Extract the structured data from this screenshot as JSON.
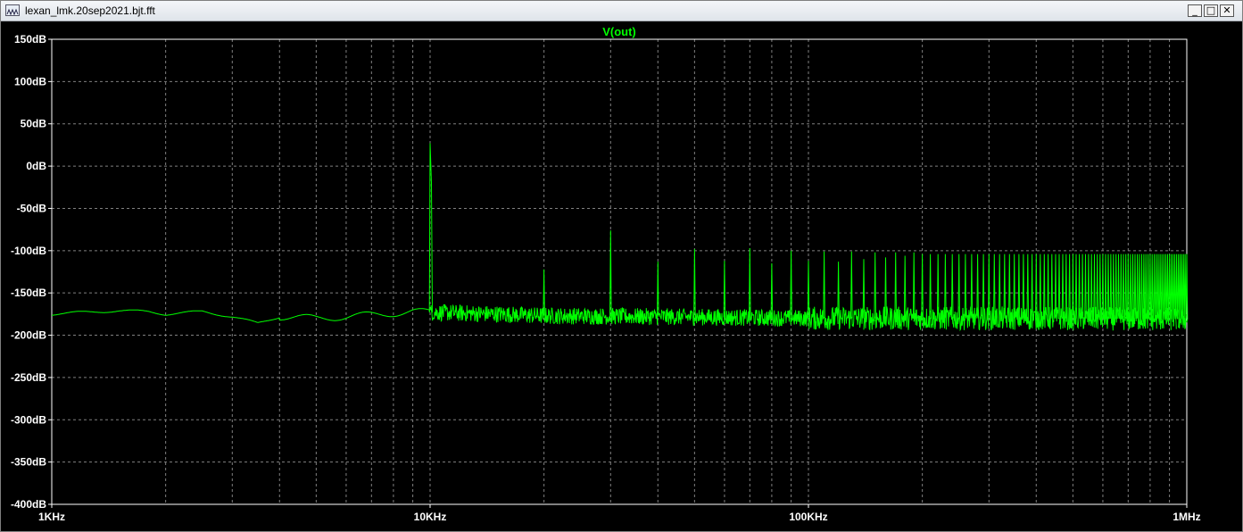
{
  "window": {
    "title": "lexan_lmk.20sep2021.bjt.fft",
    "icon": "waveform-viewer-icon",
    "buttons": {
      "minimize": "_",
      "maximize": "□",
      "close": "✕"
    }
  },
  "colors": {
    "background": "#000000",
    "grid": "#808080",
    "axis_text": "#ffffff",
    "trace": "#00ff00"
  },
  "chart_data": {
    "type": "line",
    "title": "V(out)",
    "x_scale": "log",
    "xlim": [
      1000,
      1000000
    ],
    "ylim": [
      -400,
      150
    ],
    "x_ticks": [
      {
        "value": 1000,
        "label": "1KHz"
      },
      {
        "value": 10000,
        "label": "10KHz"
      },
      {
        "value": 100000,
        "label": "100KHz"
      },
      {
        "value": 1000000,
        "label": "1MHz"
      }
    ],
    "y_ticks": [
      {
        "value": 150,
        "label": "150dB"
      },
      {
        "value": 100,
        "label": "100dB"
      },
      {
        "value": 50,
        "label": "50dB"
      },
      {
        "value": 0,
        "label": "0dB"
      },
      {
        "value": -50,
        "label": "-50dB"
      },
      {
        "value": -100,
        "label": "-100dB"
      },
      {
        "value": -150,
        "label": "-150dB"
      },
      {
        "value": -200,
        "label": "-200dB"
      },
      {
        "value": -250,
        "label": "-250dB"
      },
      {
        "value": -300,
        "label": "-300dB"
      },
      {
        "value": -350,
        "label": "-350dB"
      },
      {
        "value": -400,
        "label": "-400dB"
      }
    ],
    "grid": true,
    "series": [
      {
        "name": "V(out)",
        "color": "#00ff00",
        "noise_floor_points": [
          [
            1000,
            -175
          ],
          [
            1200,
            -173
          ],
          [
            1500,
            -171
          ],
          [
            1800,
            -172
          ],
          [
            2000,
            -175
          ],
          [
            2500,
            -172
          ],
          [
            3000,
            -178
          ],
          [
            3500,
            -186
          ],
          [
            4000,
            -178
          ],
          [
            5000,
            -180
          ],
          [
            6000,
            -178
          ],
          [
            7000,
            -176
          ],
          [
            8000,
            -174
          ],
          [
            9000,
            -172
          ],
          [
            10000,
            -173
          ],
          [
            15000,
            -175
          ],
          [
            20000,
            -177
          ],
          [
            40000,
            -178
          ],
          [
            100000,
            -180
          ],
          [
            400000,
            -180
          ],
          [
            1000000,
            -181
          ]
        ],
        "fundamental": {
          "x": 10000,
          "y": 27
        },
        "harmonics": [
          {
            "n": 2,
            "y": -122
          },
          {
            "n": 3,
            "y": -76
          },
          {
            "n": 4,
            "y": -113
          },
          {
            "n": 5,
            "y": -98
          },
          {
            "n": 6,
            "y": -112
          },
          {
            "n": 7,
            "y": -97
          },
          {
            "n": 8,
            "y": -115
          },
          {
            "n": 9,
            "y": -100
          },
          {
            "n": 10,
            "y": -112
          },
          {
            "n": 11,
            "y": -101
          },
          {
            "n": 12,
            "y": -113
          },
          {
            "n": 13,
            "y": -101
          },
          {
            "n": 14,
            "y": -110
          },
          {
            "n": 15,
            "y": -102
          },
          {
            "n": 16,
            "y": -108
          },
          {
            "n": 17,
            "y": -102
          },
          {
            "n": 18,
            "y": -106
          },
          {
            "n": 19,
            "y": -102
          },
          {
            "n": 20,
            "y": -104
          }
        ],
        "harmonics_beyond_20_level_db": -104
      }
    ]
  }
}
